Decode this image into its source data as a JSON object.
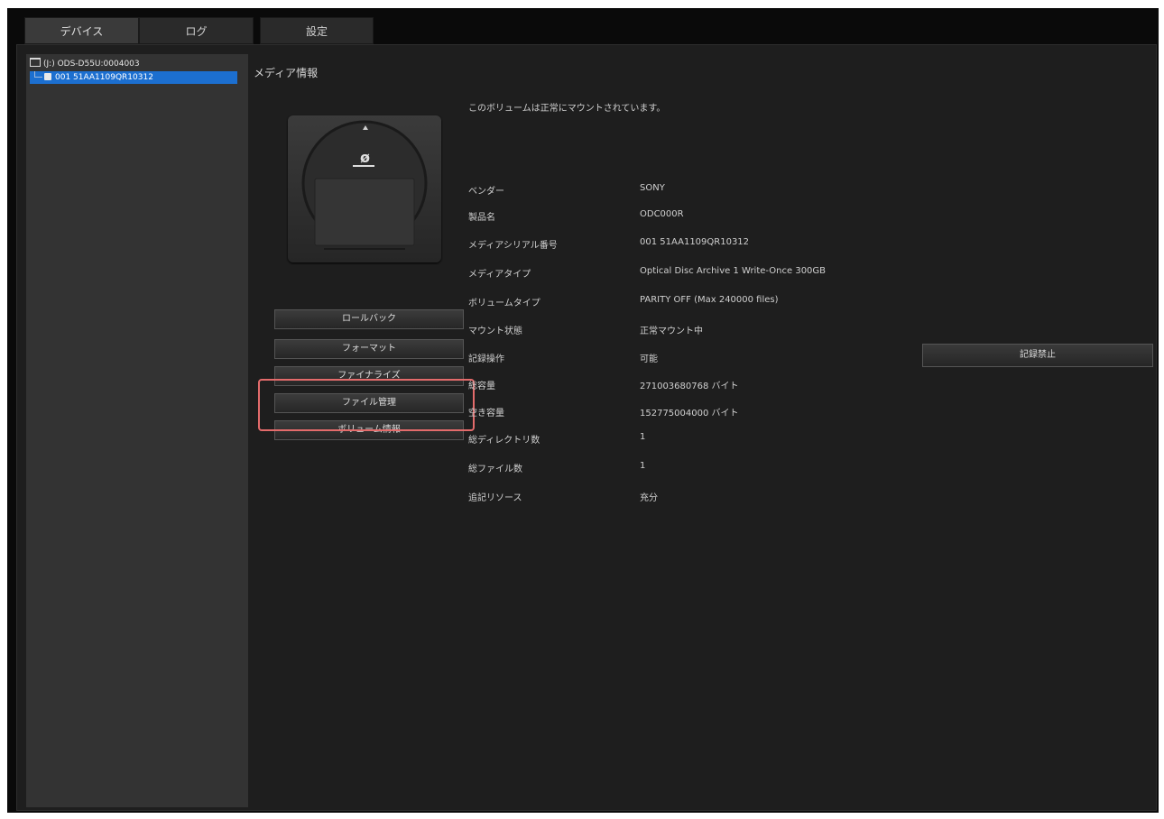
{
  "tabs": [
    {
      "label": "デバイス"
    },
    {
      "label": "ログ"
    },
    {
      "label": "設定"
    }
  ],
  "tree": {
    "device": "(J:) ODS-D55U:0004003",
    "media": "001 51AA1109QR10312"
  },
  "main": {
    "title": "メディア情報",
    "status_message": "このボリュームは正常にマウントされています。"
  },
  "buttons": {
    "rollback": "ロールバック",
    "format": "フォーマット",
    "finalize": "ファイナライズ",
    "file_manage": "ファイル管理",
    "volume_info": "ボリューム情報"
  },
  "info": [
    {
      "label": "ベンダー",
      "value": "SONY"
    },
    {
      "label": "製品名",
      "value": "ODC000R"
    },
    {
      "label": "メディアシリアル番号",
      "value": "001 51AA1109QR10312"
    },
    {
      "label": "メディアタイプ",
      "value": "Optical Disc Archive 1 Write-Once 300GB"
    },
    {
      "label": "ボリュームタイプ",
      "value": "PARITY OFF (Max 240000 files)"
    },
    {
      "label": "マウント状態",
      "value": "正常マウント中"
    },
    {
      "label": "記録操作",
      "value": "可能"
    },
    {
      "label": "総容量",
      "value": "271003680768 バイト"
    },
    {
      "label": "空き容量",
      "value": "152775004000 バイト"
    },
    {
      "label": "総ディレクトリ数",
      "value": "1"
    },
    {
      "label": "総ファイル数",
      "value": "1"
    },
    {
      "label": "追記リソース",
      "value": "充分"
    }
  ],
  "stop_button": "記録禁止",
  "colors": {
    "selection": "#1c6fd0",
    "highlight": "#e36b6b"
  }
}
